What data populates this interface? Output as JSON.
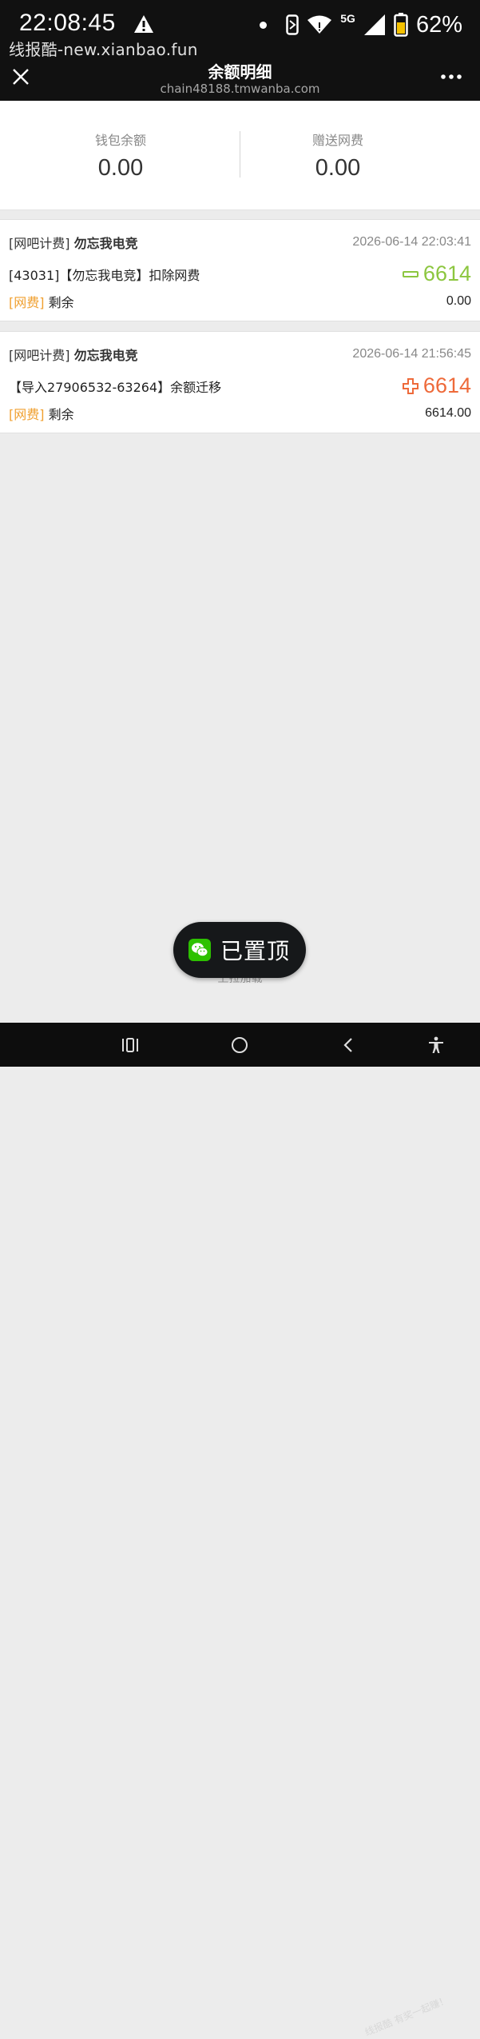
{
  "status_bar": {
    "time": "22:08:45",
    "network": "5G",
    "battery": "62%"
  },
  "watermark_top": "线报酷-new.xianbao.fun",
  "header": {
    "title": "余额明细",
    "subtitle": "chain48188.tmwanba.com"
  },
  "summary": {
    "wallet_label": "钱包余额",
    "wallet_value": "0.00",
    "gift_label": "赠送网费",
    "gift_value": "0.00"
  },
  "records": [
    {
      "category": "[网吧计费]",
      "store": "勿忘我电竞",
      "time": "2026-06-14 22:03:41",
      "description": "[43031]【勿忘我电竞】扣除网费",
      "amount": "6614",
      "sign": "minus",
      "amount_color": "#8cc63f",
      "tag": "[网费]",
      "remain_label": "剩余",
      "remain": "0.00"
    },
    {
      "category": "[网吧计费]",
      "store": "勿忘我电竞",
      "time": "2026-06-14 21:56:45",
      "description": "【导入27906532-63264】余额迁移",
      "amount": "6614",
      "sign": "plus",
      "amount_color": "#ee6a3a",
      "tag": "[网费]",
      "remain_label": "剩余",
      "remain": "6614.00"
    }
  ],
  "pull_up_text": "上拉加载",
  "toast": {
    "icon": "wechat-icon",
    "text": "已置顶"
  },
  "watermark_bottom": "线报酷 有奖一起赚！"
}
